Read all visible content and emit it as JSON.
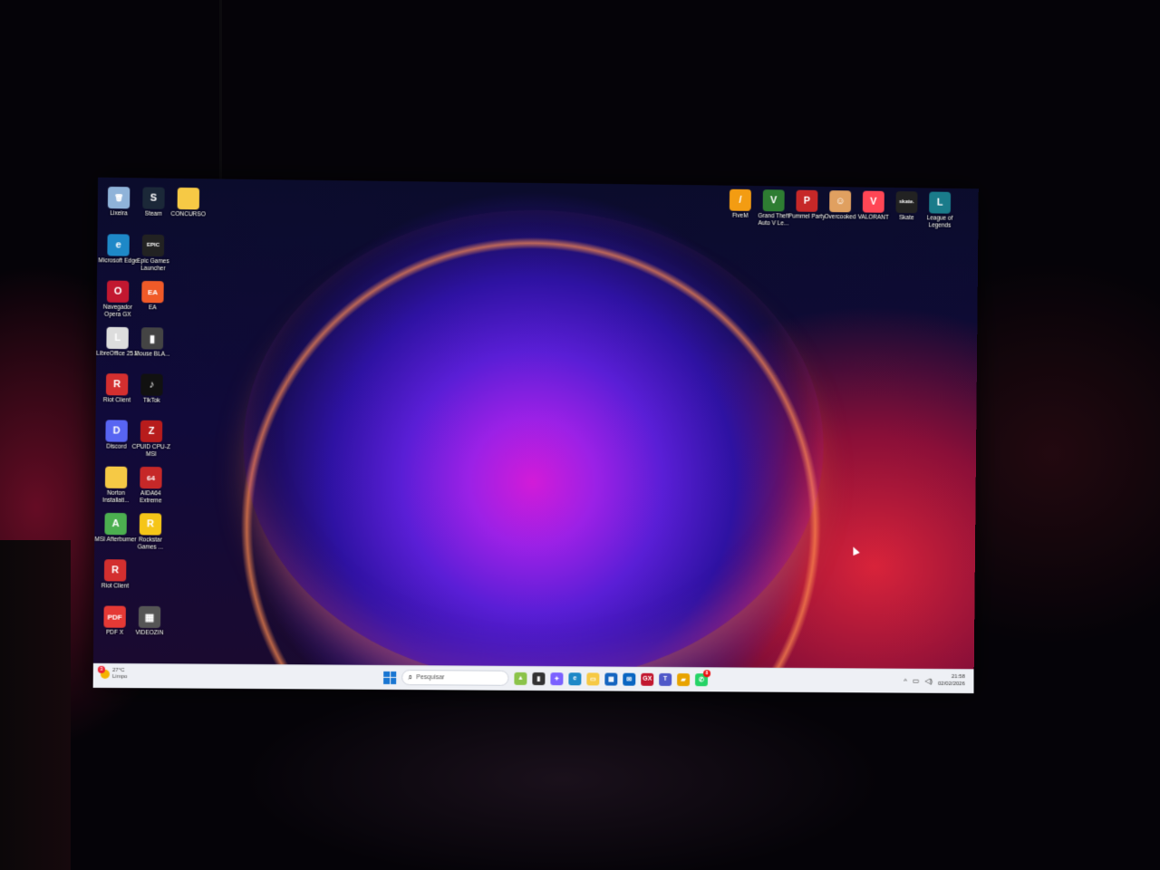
{
  "desktop": {
    "left_icons": [
      {
        "label": "Lixeira",
        "icon": "recycle-bin-icon",
        "glyph": "🗑",
        "color": "#8fb3d9"
      },
      {
        "label": "Steam",
        "icon": "steam-icon",
        "glyph": "S",
        "color": "#1b2838"
      },
      {
        "label": "CONCURSO",
        "icon": "folder-icon",
        "glyph": "",
        "color": "#f6c945"
      },
      {
        "label": "Microsoft Edge",
        "icon": "edge-icon",
        "glyph": "e",
        "color": "#1e88c7"
      },
      {
        "label": "Epic Games Launcher",
        "icon": "epic-games-icon",
        "glyph": "EPIC",
        "color": "#222"
      },
      {
        "label": "Navegador Opera GX",
        "icon": "opera-gx-icon",
        "glyph": "O",
        "color": "#c21830"
      },
      {
        "label": "EA",
        "icon": "ea-icon",
        "glyph": "EA",
        "color": "#f05a28"
      },
      {
        "label": "LibreOffice 25.2",
        "icon": "libreoffice-icon",
        "glyph": "L",
        "color": "#ddd"
      },
      {
        "label": "Mouse BLA...",
        "icon": "mouse-icon",
        "glyph": "▮",
        "color": "#444"
      },
      {
        "label": "Riot Client",
        "icon": "riot-client-icon",
        "glyph": "R",
        "color": "#d32f2f"
      },
      {
        "label": "TikTok",
        "icon": "tiktok-icon",
        "glyph": "♪",
        "color": "#111"
      },
      {
        "label": "Discord",
        "icon": "discord-icon",
        "glyph": "D",
        "color": "#5865f2"
      },
      {
        "label": "CPUID CPU-Z MSI",
        "icon": "cpuz-icon",
        "glyph": "Z",
        "color": "#b71c1c"
      },
      {
        "label": "Norton Installati...",
        "icon": "folder-icon",
        "glyph": "",
        "color": "#f6c945"
      },
      {
        "label": "AIDA64 Extreme",
        "icon": "aida64-icon",
        "glyph": "64",
        "color": "#c62828"
      },
      {
        "label": "MSI Afterburner",
        "icon": "afterburner-icon",
        "glyph": "A",
        "color": "#4caf50"
      },
      {
        "label": "Rockstar Games ...",
        "icon": "rockstar-icon",
        "glyph": "R",
        "color": "#f5c518"
      },
      {
        "label": "Riot Client",
        "icon": "riot-client-icon",
        "glyph": "R",
        "color": "#d32f2f"
      },
      {
        "label": "PDF X",
        "icon": "pdf-icon",
        "glyph": "PDF",
        "color": "#e53935"
      },
      {
        "label": "VIDEOZIN",
        "icon": "video-file-icon",
        "glyph": "▦",
        "color": "#555"
      }
    ],
    "top_right_icons": [
      {
        "label": "FiveM",
        "icon": "fivem-icon",
        "glyph": "/",
        "color": "#f39c12"
      },
      {
        "label": "Grand Theft Auto V Le...",
        "icon": "gta-icon",
        "glyph": "V",
        "color": "#2e7d32"
      },
      {
        "label": "Pummel Party",
        "icon": "pummel-party-icon",
        "glyph": "P",
        "color": "#c62828"
      },
      {
        "label": "Overcooked",
        "icon": "overcooked-icon",
        "glyph": "☺",
        "color": "#e0a060"
      },
      {
        "label": "VALORANT",
        "icon": "valorant-icon",
        "glyph": "V",
        "color": "#ff4655"
      },
      {
        "label": "Skate",
        "icon": "skate-icon",
        "glyph": "skate.",
        "color": "#222"
      },
      {
        "label": "League of Legends",
        "icon": "league-icon",
        "glyph": "L",
        "color": "#1a7b8a"
      }
    ]
  },
  "taskbar": {
    "weather_temp": "27°C",
    "weather_desc": "Limpo",
    "weather_badge": "3",
    "search_placeholder": "Pesquisar",
    "apps": [
      {
        "icon": "game-app-icon",
        "glyph": "▲",
        "color": "#8bc34a"
      },
      {
        "icon": "terminal-icon",
        "glyph": "▮",
        "color": "#333"
      },
      {
        "icon": "copilot-icon",
        "glyph": "✦",
        "color": "#7b61ff"
      },
      {
        "icon": "edge-icon",
        "glyph": "e",
        "color": "#1e88c7"
      },
      {
        "icon": "file-explorer-icon",
        "glyph": "▭",
        "color": "#f6c945"
      },
      {
        "icon": "store-icon",
        "glyph": "▦",
        "color": "#1565c0"
      },
      {
        "icon": "outlook-icon",
        "glyph": "✉",
        "color": "#0a66c2"
      },
      {
        "icon": "opera-gx-icon",
        "glyph": "GX",
        "color": "#c21830"
      },
      {
        "icon": "teams-icon",
        "glyph": "T",
        "color": "#5059c9"
      },
      {
        "icon": "office-icon",
        "glyph": "▰",
        "color": "#e8a300"
      },
      {
        "icon": "whatsapp-icon",
        "glyph": "✆",
        "color": "#25d366"
      }
    ],
    "whatsapp_badge": "8",
    "time": "21:58",
    "date": "02/02/2026"
  }
}
